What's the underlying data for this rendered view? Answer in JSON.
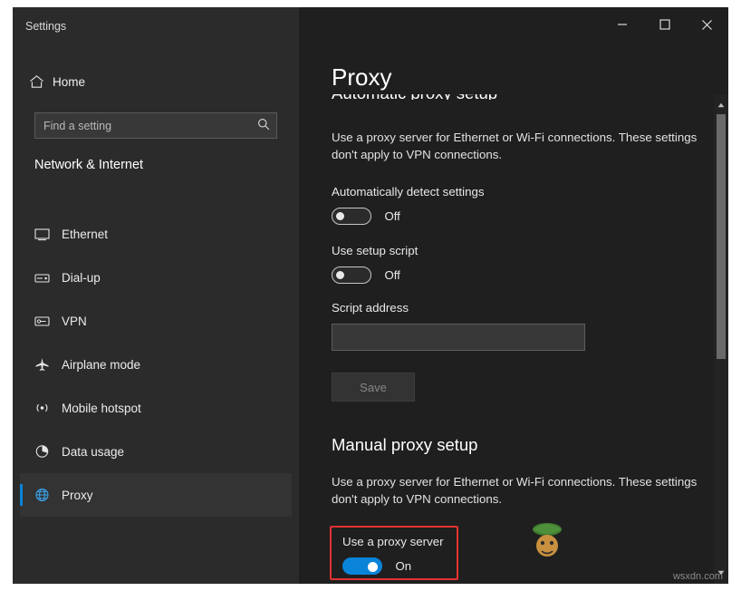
{
  "window": {
    "left_title": "Settings",
    "titlebar": {
      "minimize": "–",
      "maximize": "☐",
      "close": "✕"
    }
  },
  "sidebar": {
    "home": {
      "label": "Home",
      "icon": "home-icon"
    },
    "search": {
      "placeholder": "Find a setting",
      "icon": "search-icon"
    },
    "category": "Network & Internet",
    "items": [
      {
        "label": "Ethernet",
        "icon": "ethernet-icon",
        "selected": false
      },
      {
        "label": "Dial-up",
        "icon": "dialup-icon",
        "selected": false
      },
      {
        "label": "VPN",
        "icon": "vpn-icon",
        "selected": false
      },
      {
        "label": "Airplane mode",
        "icon": "airplane-icon",
        "selected": false
      },
      {
        "label": "Mobile hotspot",
        "icon": "hotspot-icon",
        "selected": false
      },
      {
        "label": "Data usage",
        "icon": "data-usage-icon",
        "selected": false
      },
      {
        "label": "Proxy",
        "icon": "globe-icon",
        "selected": true
      }
    ]
  },
  "page": {
    "title": "Proxy",
    "auto_section": {
      "clipped_heading": "Automatic proxy setup",
      "description": "Use a proxy server for Ethernet or Wi-Fi connections. These settings don't apply to VPN connections.",
      "auto_detect": {
        "label": "Automatically detect settings",
        "state": "Off",
        "on": false
      },
      "setup_script": {
        "label": "Use setup script",
        "state": "Off",
        "on": false
      },
      "script_address": {
        "label": "Script address",
        "value": ""
      },
      "save_button": "Save"
    },
    "manual_section": {
      "heading": "Manual proxy setup",
      "description": "Use a proxy server for Ethernet or Wi-Fi connections. These settings don't apply to VPN connections.",
      "use_proxy": {
        "label": "Use a proxy server",
        "state": "On",
        "on": true
      }
    }
  },
  "scrollbar": {
    "up_arrow": "▲",
    "down_arrow": "▼"
  },
  "watermark": {
    "text": "wsxdn.com"
  },
  "colors": {
    "accent": "#0a84d8",
    "highlight": "#e33232",
    "window_bg": "#1f1f1f",
    "sidebar_bg": "#2b2b2b"
  }
}
